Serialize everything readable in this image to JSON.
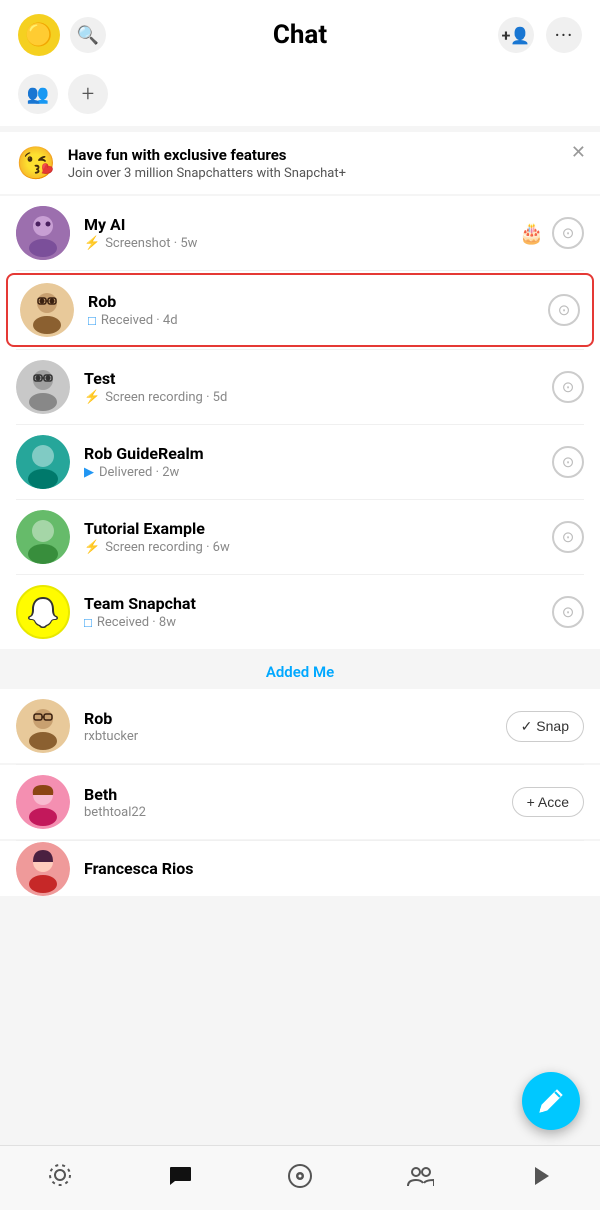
{
  "header": {
    "title": "Chat",
    "add_friend_label": "+👤",
    "more_label": "•••"
  },
  "subheader": {
    "groups_icon": "👥",
    "add_icon": "+"
  },
  "promo": {
    "emoji": "😘",
    "title": "Have fun with exclusive features",
    "subtitle": "Join over 3 million Snapchatters with Snapchat+"
  },
  "chats": [
    {
      "id": "my-ai",
      "name": "My AI",
      "status_icon": "⚡",
      "status_text": "Screenshot · 5w",
      "has_birthday": true,
      "avatar_color": "purple",
      "highlighted": false
    },
    {
      "id": "rob",
      "name": "Rob",
      "status_icon": "□",
      "status_text": "Received · 4d",
      "has_birthday": false,
      "avatar_color": "brown",
      "highlighted": true
    },
    {
      "id": "test",
      "name": "Test",
      "status_icon": "⚡",
      "status_text": "Screen recording · 5d",
      "has_birthday": false,
      "avatar_color": "gray",
      "highlighted": false
    },
    {
      "id": "rob-guide",
      "name": "Rob GuideRealm",
      "status_icon": "▶",
      "status_text": "Delivered · 2w",
      "has_birthday": false,
      "avatar_color": "teal",
      "highlighted": false
    },
    {
      "id": "tutorial",
      "name": "Tutorial Example",
      "status_icon": "⚡",
      "status_text": "Screen recording · 6w",
      "has_birthday": false,
      "avatar_color": "green",
      "highlighted": false
    },
    {
      "id": "team-snapchat",
      "name": "Team Snapchat",
      "status_icon": "□",
      "status_text": "Received · 8w",
      "has_birthday": false,
      "avatar_color": "yellow-snap",
      "highlighted": false
    }
  ],
  "added_me_label": "Added Me",
  "added_me_users": [
    {
      "id": "rob-added",
      "name": "Rob",
      "handle": "rxbtucker",
      "action": "✓ Snap",
      "avatar_color": "brown"
    },
    {
      "id": "beth-added",
      "name": "Beth",
      "handle": "bethtoal22",
      "action": "+ Acce",
      "avatar_color": "pink"
    },
    {
      "id": "francesca-added",
      "name": "Francesca Rios",
      "handle": "",
      "action": "",
      "avatar_color": "red"
    }
  ],
  "nav": {
    "map": "◎",
    "chat": "💬",
    "camera": "⊙",
    "friends": "👥",
    "stories": "▷"
  }
}
